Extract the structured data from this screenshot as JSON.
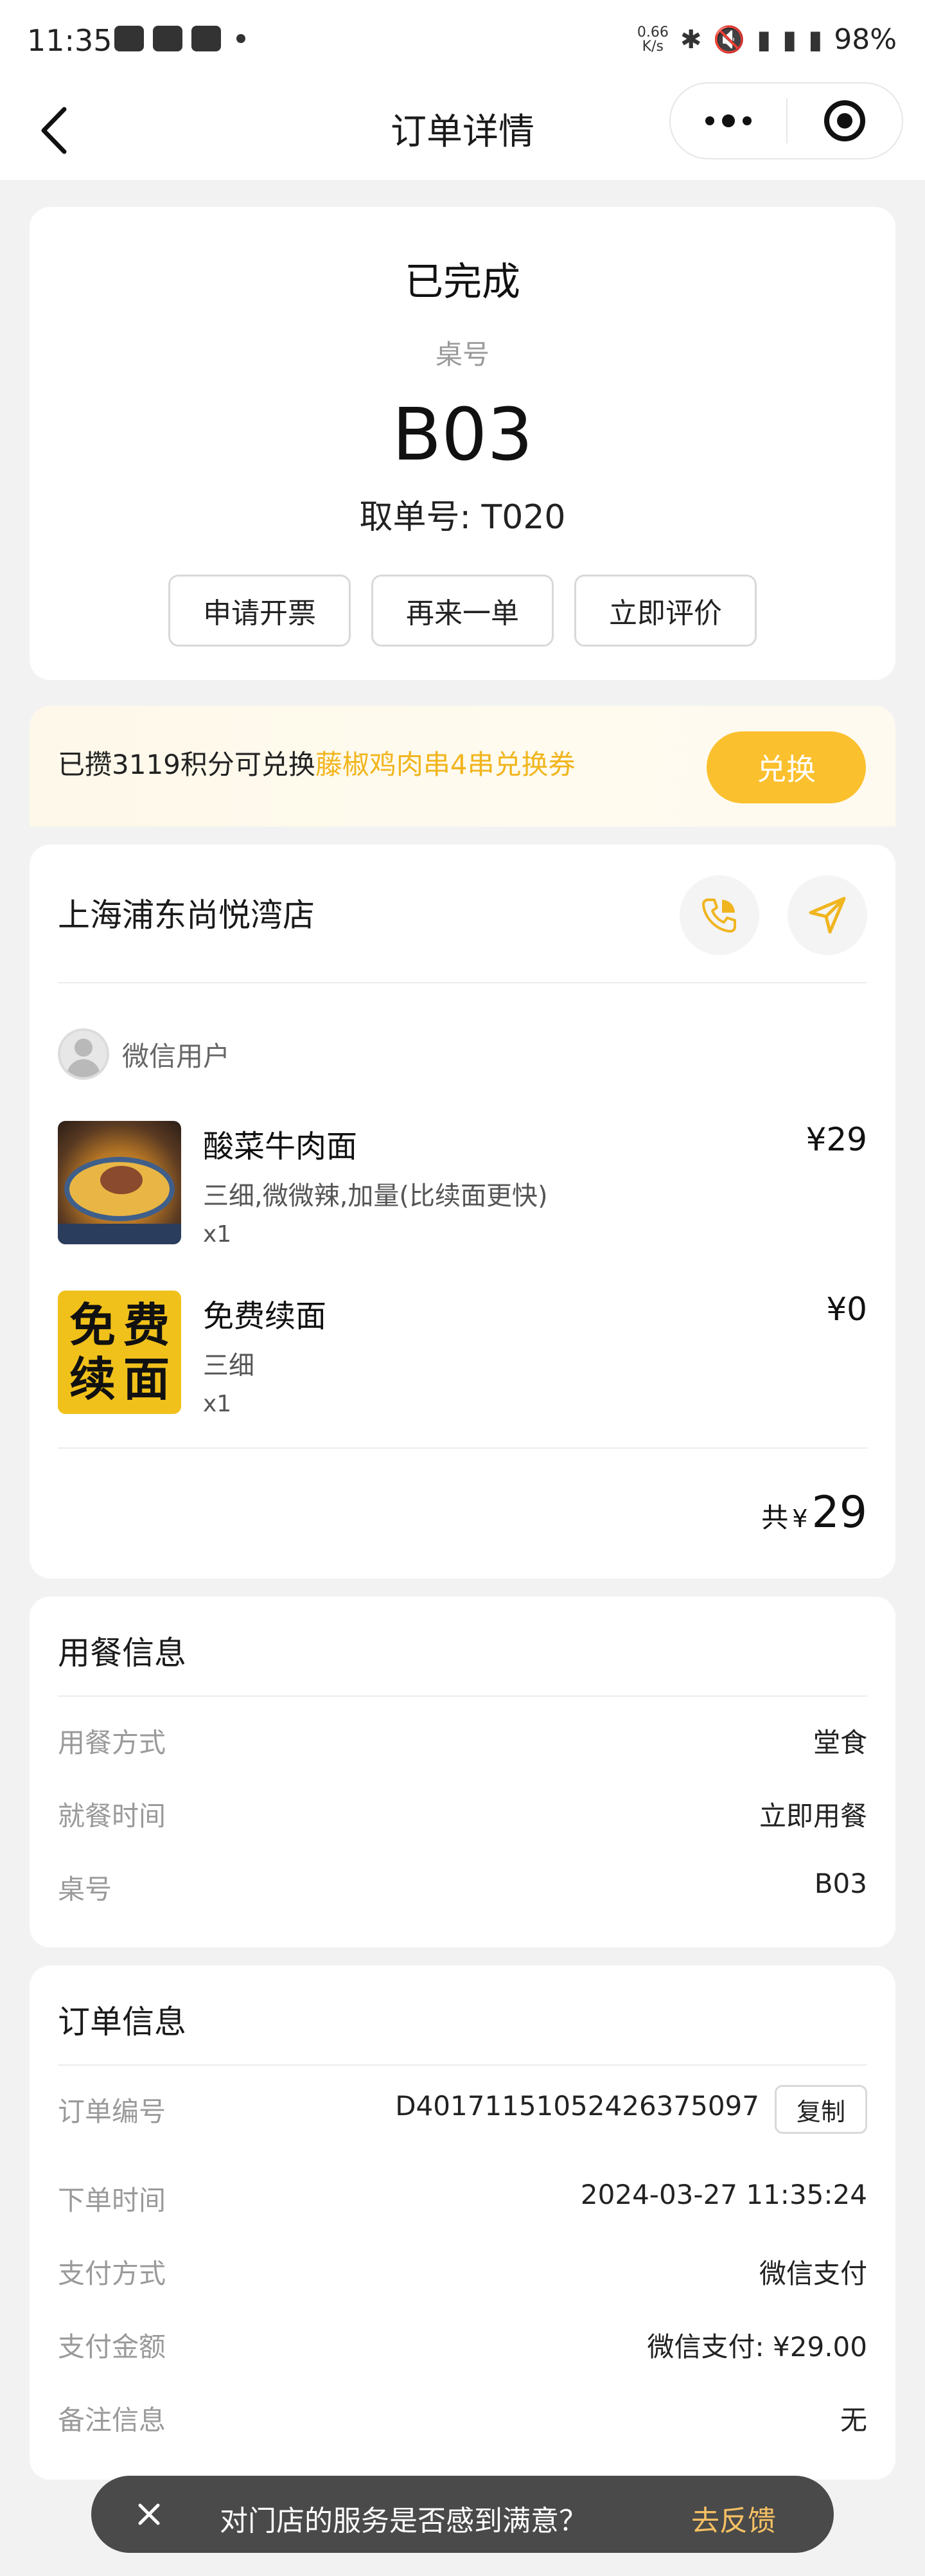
{
  "status_bar": {
    "time": "11:35",
    "speed_top": "0.66",
    "speed_bottom": "K/s",
    "battery": "98%"
  },
  "nav": {
    "title": "订单详情"
  },
  "order_status": {
    "status": "已完成",
    "table_label": "桌号",
    "table_number": "B03",
    "pickup": "取单号: T020",
    "actions": [
      "申请开票",
      "再来一单",
      "立即评价"
    ]
  },
  "points": {
    "prefix": "已攒3119积分可兑换",
    "highlight": "藤椒鸡肉串4串兑换券",
    "button": "兑换",
    "accent": "#fbc02d"
  },
  "shop": {
    "name": "上海浦东尚悦湾店",
    "user": "微信用户",
    "items": [
      {
        "name": "酸菜牛肉面",
        "spec": "三细,微微辣,加量(比续面更快)",
        "qty": "x1",
        "price": "¥29"
      },
      {
        "name": "免费续面",
        "spec": "三细",
        "qty": "x1",
        "price": "¥0",
        "thumb_text": [
          "免",
          "费",
          "续",
          "面"
        ]
      }
    ],
    "total_label": "共",
    "total_currency": "¥",
    "total_amount": "29"
  },
  "dining": {
    "title": "用餐信息",
    "rows": [
      {
        "k": "用餐方式",
        "v": "堂食"
      },
      {
        "k": "就餐时间",
        "v": "立即用餐"
      },
      {
        "k": "桌号",
        "v": "B03"
      }
    ]
  },
  "order_info": {
    "title": "订单信息",
    "order_no_label": "订单编号",
    "order_no": "D40171151052426375097",
    "copy": "复制",
    "rows": [
      {
        "k": "下单时间",
        "v": "2024-03-27 11:35:24"
      },
      {
        "k": "支付方式",
        "v": "微信支付"
      },
      {
        "k": "支付金额",
        "v": "微信支付: ¥29.00"
      },
      {
        "k": "备注信息",
        "v": "无"
      }
    ]
  },
  "feedback": {
    "message": "对门店的服务是否感到满意？",
    "action": "去反馈"
  }
}
